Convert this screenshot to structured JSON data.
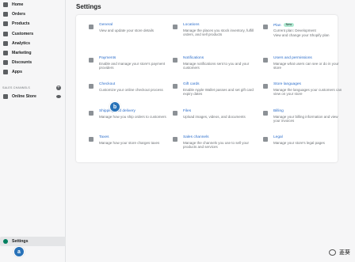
{
  "sidebar": {
    "items": [
      {
        "label": "Home",
        "icon": "home-icon"
      },
      {
        "label": "Orders",
        "icon": "orders-icon"
      },
      {
        "label": "Products",
        "icon": "tag-icon"
      },
      {
        "label": "Customers",
        "icon": "person-icon"
      },
      {
        "label": "Analytics",
        "icon": "bar-chart-icon"
      },
      {
        "label": "Marketing",
        "icon": "megaphone-icon"
      },
      {
        "label": "Discounts",
        "icon": "discount-icon"
      },
      {
        "label": "Apps",
        "icon": "apps-icon"
      }
    ],
    "sales_channels_label": "SALES CHANNELS",
    "online_store_label": "Online Store",
    "settings_label": "Settings"
  },
  "main": {
    "title": "Settings",
    "tiles": [
      {
        "title": "General",
        "desc": "View and update your store details",
        "icon": "gear-icon"
      },
      {
        "title": "Locations",
        "desc": "Manage the places you stock inventory, fulfill orders, and sell products",
        "icon": "location-pin-icon"
      },
      {
        "title": "Plan",
        "badge": "New",
        "line": "Current plan: Development",
        "desc": "View and change your Shopify plan",
        "icon": "plan-icon"
      },
      {
        "title": "Payments",
        "desc": "Enable and manage your store's payment providers",
        "icon": "payment-icon"
      },
      {
        "title": "Notifications",
        "desc": "Manage notifications sent to you and your customers",
        "icon": "bell-icon"
      },
      {
        "title": "Users and permissions",
        "desc": "Manage what users can see or do in your store",
        "icon": "user-icon"
      },
      {
        "title": "Checkout",
        "desc": "Customize your online checkout process",
        "icon": "cart-icon"
      },
      {
        "title": "Gift cards",
        "desc": "Enable Apple Wallet passes and set gift card expiry dates",
        "icon": "gift-icon"
      },
      {
        "title": "Store languages",
        "desc": "Manage the languages your customers can view on your store",
        "icon": "globe-icon"
      },
      {
        "title": "Shipping and delivery",
        "desc": "Manage how you ship orders to customers",
        "icon": "truck-icon"
      },
      {
        "title": "Files",
        "desc": "Upload images, videos, and documents",
        "icon": "paperclip-icon"
      },
      {
        "title": "Billing",
        "desc": "Manage your billing information and view your invoices",
        "icon": "billing-icon"
      },
      {
        "title": "Taxes",
        "desc": "Manage how your store charges taxes",
        "icon": "tax-icon"
      },
      {
        "title": "Sales channels",
        "desc": "Manage the channels you use to sell your products and services",
        "icon": "channels-icon"
      },
      {
        "title": "Legal",
        "desc": "Manage your store's legal pages",
        "icon": "legal-icon"
      }
    ]
  },
  "markers": {
    "a": "a",
    "b": "b"
  },
  "watermark": "菱葵"
}
